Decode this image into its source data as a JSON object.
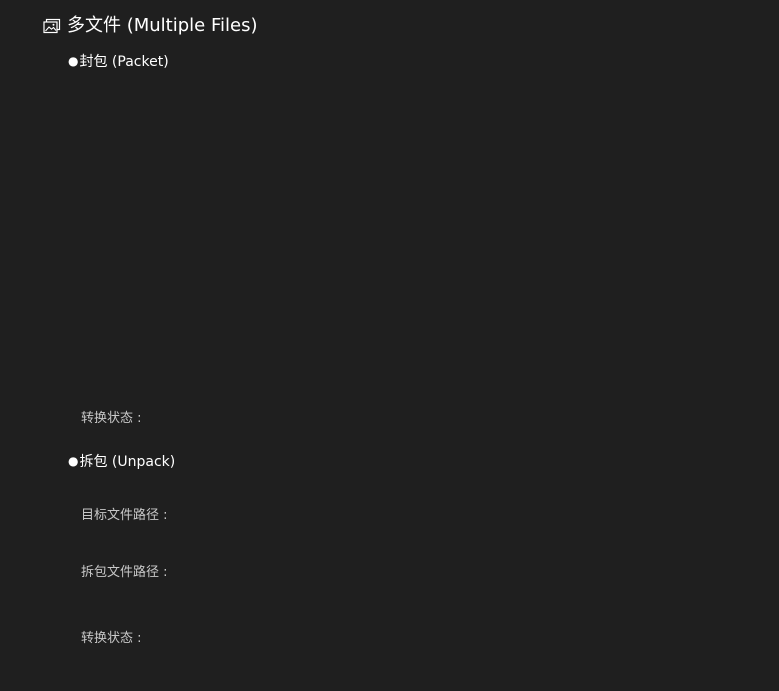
{
  "header": {
    "icon": "image-gallery-icon",
    "title": "多文件 (Multiple Files)"
  },
  "packet": {
    "bullet": "●",
    "title": "封包 (Packet)",
    "status_label": "转换状态 :",
    "status_value": ""
  },
  "unpack": {
    "bullet": "●",
    "title": "拆包 (Unpack)",
    "target_path_label": "目标文件路径 :",
    "target_path_value": "",
    "unpack_path_label": "拆包文件路径 :",
    "unpack_path_value": "",
    "status_label": "转换状态 :",
    "status_value": ""
  },
  "colors": {
    "background": "#1f1f1f",
    "title_text": "#ffffff",
    "label_text": "#c8c8c8"
  }
}
